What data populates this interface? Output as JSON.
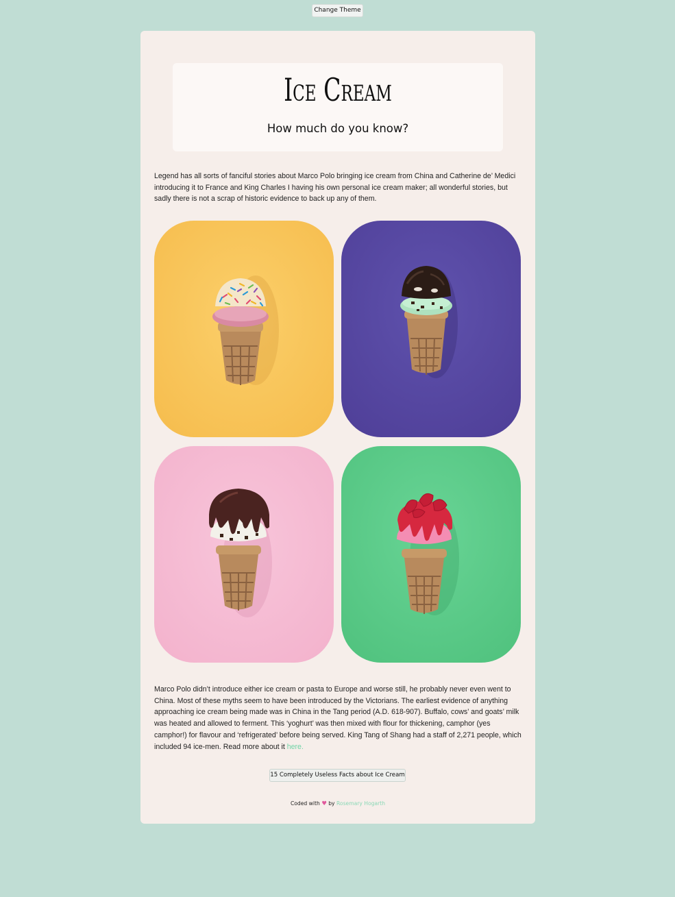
{
  "toolbar": {
    "theme_button_label": "Change Theme"
  },
  "header": {
    "title": "Ice Cream",
    "subtitle": "How much do you know?"
  },
  "intro": {
    "text": "Legend has all sorts of fanciful stories about Marco Polo bringing ice cream from China and Catherine de’ Medici introducing it to France and King Charles I having his own personal ice cream maker; all wonderful stories, but sadly there is not a scrap of historic evidence to back up any of them."
  },
  "gallery": {
    "tiles": [
      {
        "name": "sprinkles-on-pink-cone",
        "background": "#f9c65a",
        "scoop": "#d88aa0",
        "topping": "sprinkles"
      },
      {
        "name": "mint-chip-chocolate-cone",
        "background": "#5a4aa6",
        "scoop": "#b8e8c8",
        "topping": "chocolate"
      },
      {
        "name": "vanilla-chocolate-drizzle-cone",
        "background": "#f5b8d0",
        "scoop": "#f1f0ea",
        "topping": "chocolate-drizzle"
      },
      {
        "name": "strawberry-syrup-cone",
        "background": "#5cca88",
        "scoop": "#f08ab0",
        "topping": "strawberry"
      }
    ]
  },
  "history": {
    "text": "Marco Polo didn’t introduce either ice cream or pasta to Europe and worse still, he probably never even went to China. Most of these myths seem to have been introduced by the Victorians. The earliest evidence of anything approaching ice cream being made was in China in the Tang period (A.D. 618-907). Buffalo, cows’ and goats’ milk was heated and allowed to ferment. This ‘yoghurt’ was then mixed with flour for thickening, camphor (yes camphor!) for flavour and ‘refrigerated’ before being served. King Tang of Shang had a staff of 2,271 people, which included 94 ice-men. Read more about it ",
    "link_label": "here."
  },
  "facts_button_label": "15 Completely Useless Facts about Ice Cream",
  "footer": {
    "prefix": "Coded with",
    "heart": "♥",
    "by": "by",
    "author": "Rosemary Hogarth"
  },
  "colors": {
    "page_background": "#c0ddd4",
    "card_background": "#f6eeea",
    "link": "#6fd3a5",
    "heart": "#e0589c"
  }
}
